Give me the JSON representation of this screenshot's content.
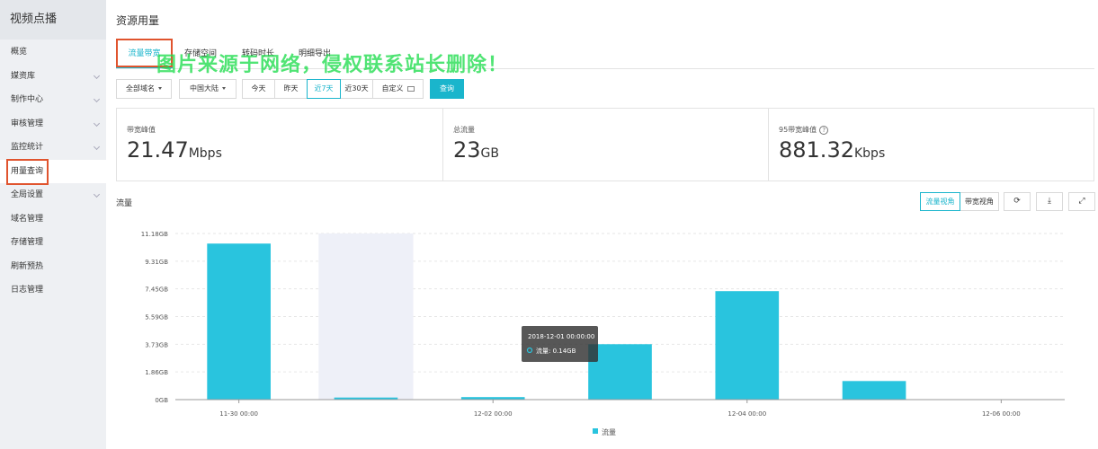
{
  "app": {
    "title": "视频点播"
  },
  "sidebar": {
    "items": [
      {
        "label": "概览",
        "chevron": false,
        "active": false
      },
      {
        "label": "媒资库",
        "chevron": true,
        "active": false
      },
      {
        "label": "制作中心",
        "chevron": true,
        "active": false
      },
      {
        "label": "审核管理",
        "chevron": true,
        "active": false
      },
      {
        "label": "监控统计",
        "chevron": true,
        "active": false
      },
      {
        "label": "用量查询",
        "chevron": false,
        "active": true
      },
      {
        "label": "全局设置",
        "chevron": true,
        "active": false
      },
      {
        "label": "域名管理",
        "chevron": false,
        "active": false
      },
      {
        "label": "存储管理",
        "chevron": false,
        "active": false
      },
      {
        "label": "刷新预热",
        "chevron": false,
        "active": false
      },
      {
        "label": "日志管理",
        "chevron": false,
        "active": false
      }
    ]
  },
  "page": {
    "title": "资源用量"
  },
  "tabs": [
    {
      "label": "流量带宽",
      "active": true
    },
    {
      "label": "存储空间",
      "active": false
    },
    {
      "label": "转码时长",
      "active": false
    },
    {
      "label": "明细导出",
      "active": false
    }
  ],
  "watermark": {
    "text": "图片来源于网络，侵权联系站长删除！"
  },
  "filters": {
    "domain_select": "全部域名",
    "region_select": "中国大陆",
    "time_ranges": [
      "今天",
      "昨天",
      "近7天",
      "近30天"
    ],
    "selected_range": "近7天",
    "custom_label": "自定义",
    "query_button": "查询"
  },
  "stats": [
    {
      "label": "带宽峰值",
      "value": "21.47",
      "unit": "Mbps",
      "help": false
    },
    {
      "label": "总流量",
      "value": "23",
      "unit": "GB",
      "help": false
    },
    {
      "label": "95带宽峰值",
      "value": "881.32",
      "unit": "Kbps",
      "help": true
    }
  ],
  "chart_section": {
    "title": "流量",
    "view_toggle": [
      "流量视角",
      "带宽视角"
    ],
    "selected_view": "流量视角",
    "tool_icons": [
      "refresh-icon",
      "download-icon",
      "fullscreen-icon"
    ]
  },
  "tooltip": {
    "title": "2018-12-01 00:00:00",
    "series_label": "流量",
    "value": "0.14GB"
  },
  "colors": {
    "accent": "#1ab5cc",
    "bar": "#29c4de",
    "highlight_box": "#e0542e",
    "sidebar_bg": "#eef0f3"
  },
  "chart_data": {
    "type": "bar",
    "categories": [
      "2018-11-30",
      "2018-12-01",
      "2018-12-02",
      "2018-12-03",
      "2018-12-04",
      "2018-12-05",
      "2018-12-06"
    ],
    "x_tick_labels": [
      "11-30 00:00",
      "12-02 00:00",
      "12-04 00:00",
      "12-06 00:00"
    ],
    "x_tick_categories": [
      0,
      2,
      4,
      6
    ],
    "y_tick_labels": [
      "0GB",
      "1.86GB",
      "3.73GB",
      "5.59GB",
      "7.45GB",
      "9.31GB",
      "11.18GB"
    ],
    "ylim": [
      0,
      11.18
    ],
    "y_unit": "GB",
    "series": [
      {
        "name": "流量",
        "values": [
          10.5,
          0.14,
          0.17,
          3.73,
          7.3,
          1.25,
          0
        ]
      }
    ],
    "hover_index": 1,
    "legend": "bottom-center",
    "grid": true,
    "title": "",
    "xlabel": "",
    "ylabel": ""
  }
}
